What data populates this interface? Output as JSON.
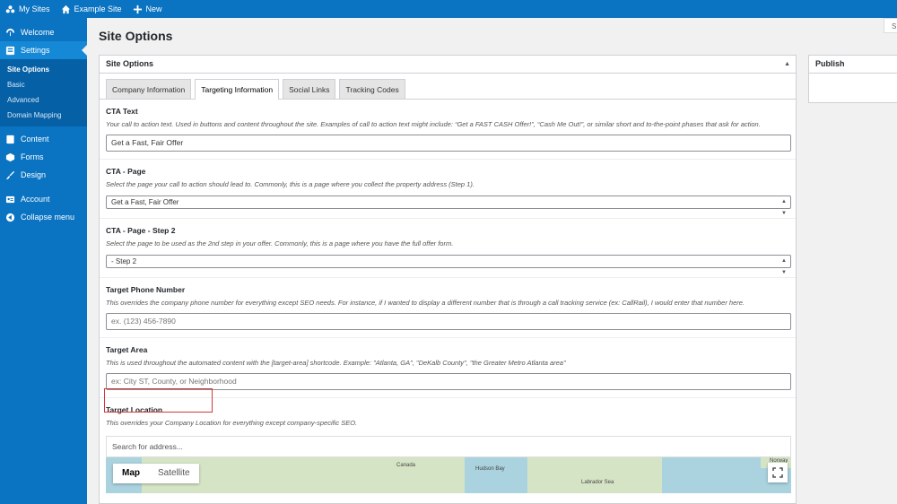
{
  "adminbar": {
    "my_sites": "My Sites",
    "site_name": "Example Site",
    "new": "New"
  },
  "sidebar": {
    "welcome": "Welcome",
    "settings": "Settings",
    "submenu": [
      "Site Options",
      "Basic",
      "Advanced",
      "Domain Mapping"
    ],
    "content": "Content",
    "forms": "Forms",
    "design": "Design",
    "account": "Account",
    "collapse": "Collapse menu"
  },
  "page": {
    "title": "Site Options",
    "screen_options": "S"
  },
  "postbox": {
    "title": "Site Options",
    "toggle": "▲",
    "tabs": [
      "Company Information",
      "Targeting Information",
      "Social Links",
      "Tracking Codes"
    ],
    "active_tab": "Targeting Information"
  },
  "fields": {
    "cta_text": {
      "label": "CTA Text",
      "desc": "Your call to action text. Used in buttons and content throughout the site. Examples of call to action text might include: “Get a FAST CASH Offer!”, “Cash Me Out!”, or similar short and to-the-point phases that ask for action.",
      "value": "Get a Fast, Fair Offer"
    },
    "cta_page": {
      "label": "CTA - Page",
      "desc": "Select the page your call to action should lead to. Commonly, this is a page where you collect the property address (Step 1).",
      "value": "Get a Fast, Fair Offer"
    },
    "cta_page_step2": {
      "label": "CTA - Page - Step 2",
      "desc": "Select the page to be used as the 2nd step in your offer. Commonly, this is a page where you have the full offer form.",
      "value": "- Step 2"
    },
    "target_phone": {
      "label": "Target Phone Number",
      "desc": "This overrides the company phone number for everything except SEO needs. For instance, if I wanted to display a different number that is through a call tracking service (ex: CallRail), I would enter that number here.",
      "placeholder": "ex. (123) 456-7890"
    },
    "target_area": {
      "label": "Target Area",
      "desc": "This is used throughout the automated content with the [target-area] shortcode. Example: \"Atlanta, GA\", \"DeKalb County\", \"the Greater Metro Atlanta area\"",
      "placeholder": "ex: City ST, County, or Neighborhood"
    },
    "target_location": {
      "label": "Target Location",
      "desc": "This overrides your Company Location for everything except company-specific SEO.",
      "search_placeholder": "Search for address..."
    }
  },
  "map": {
    "map_btn": "Map",
    "satellite_btn": "Satellite",
    "places": [
      "Canada",
      "Hudson Bay",
      "Labrador Sea",
      "Norway"
    ]
  },
  "publish": {
    "title": "Publish"
  },
  "colors": {
    "brand": "#0a73c2",
    "highlight": "#d63638"
  }
}
